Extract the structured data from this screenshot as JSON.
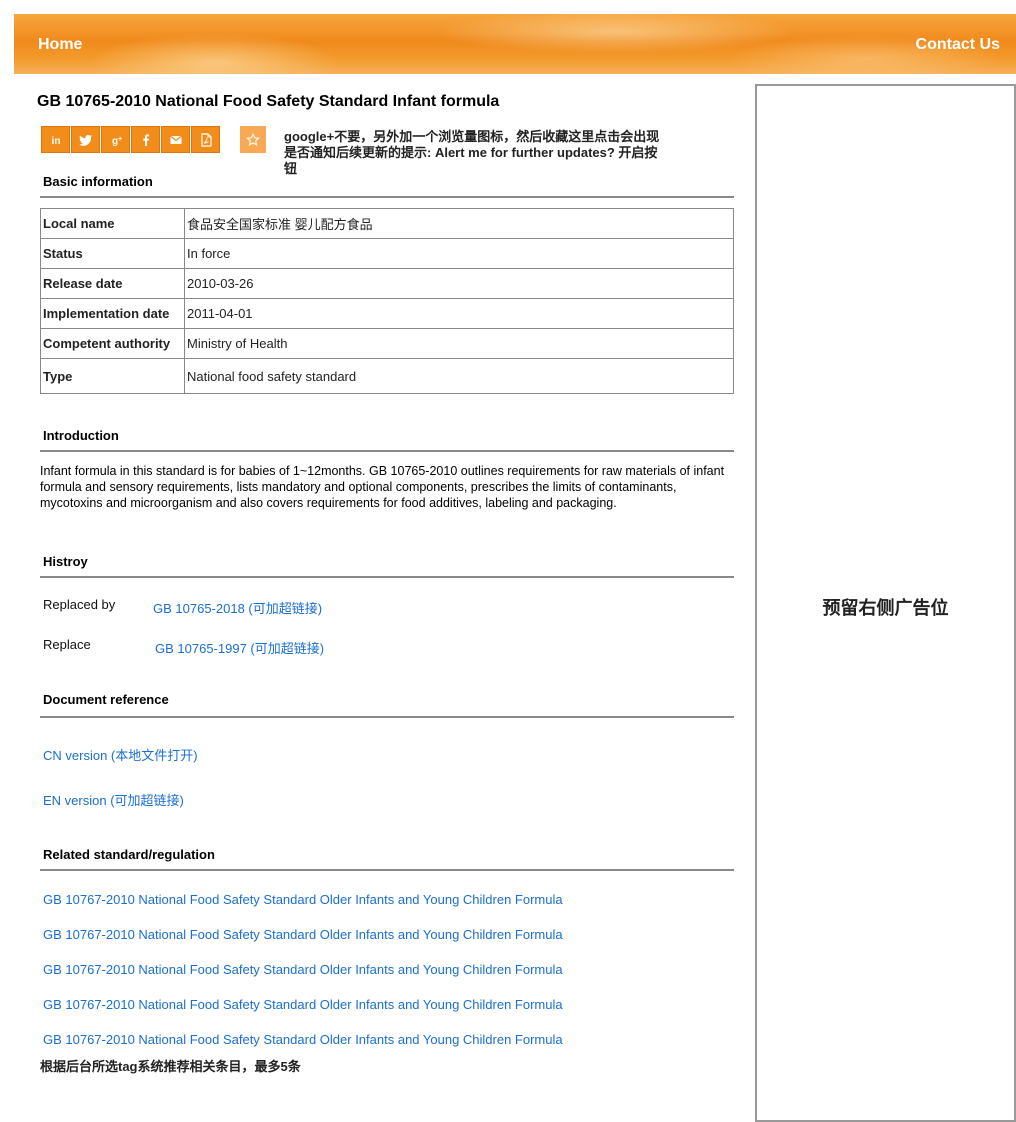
{
  "header": {
    "home_label": "Home",
    "contact_label": "Contact Us"
  },
  "page_title": "GB 10765-2010 National Food Safety Standard Infant formula",
  "share": {
    "icons": [
      "linkedin-icon",
      "twitter-icon",
      "google-plus-icon",
      "facebook-icon",
      "email-icon",
      "pdf-icon"
    ],
    "star_icon": "star-icon",
    "note": "google+不要，另外加一个浏览量图标，然后收藏这里点击会出现是否通知后续更新的提示: Alert me for further updates? 开启按钮"
  },
  "basic": {
    "title": "Basic information",
    "rows": [
      {
        "key": "Local name",
        "value": "食品安全国家标准 婴儿配方食品"
      },
      {
        "key": "Status",
        "value": "In force"
      },
      {
        "key": "Release date",
        "value": "2010-03-26"
      },
      {
        "key": "Implementation date",
        "value": "2011-04-01"
      },
      {
        "key": "Competent authority",
        "value": "Ministry of Health"
      },
      {
        "key": "Type",
        "value": "National food safety standard"
      }
    ]
  },
  "introduction": {
    "title": "Introduction",
    "text": "Infant formula in this standard is for babies of 1~12months. GB 10765-2010 outlines requirements for raw materials of infant formula and sensory requirements, lists mandatory and optional components, prescribes the limits of contaminants, mycotoxins and microorganism and also covers requirements for food additives, labeling and packaging."
  },
  "history": {
    "title": "Histroy",
    "replaced_by_label": "Replaced by",
    "replaced_by_link": "GB 10765-2018 (可加超链接)",
    "replace_label": "Replace",
    "replace_link": "GB 10765-1997 (可加超链接)"
  },
  "docs": {
    "title": "Document reference",
    "cn": "CN version (本地文件打开)",
    "en": "EN version (可加超链接)"
  },
  "related": {
    "title": "Related standard/regulation",
    "items": [
      "GB 10767-2010 National Food Safety Standard Older Infants and Young Children Formula",
      "GB 10767-2010 National Food Safety Standard Older Infants and Young Children Formula",
      "GB 10767-2010 National Food Safety Standard Older Infants and Young Children Formula",
      "GB 10767-2010 National Food Safety Standard Older Infants and Young Children Formula",
      "GB 10767-2010 National Food Safety Standard Older Infants and Young Children Formula"
    ],
    "note": "根据后台所选tag系统推荐相关条目，最多5条"
  },
  "sidebar": {
    "ad_text": "预留右侧广告位"
  },
  "colors": {
    "accent": "#f28d1c",
    "link": "#1a6fd0"
  }
}
